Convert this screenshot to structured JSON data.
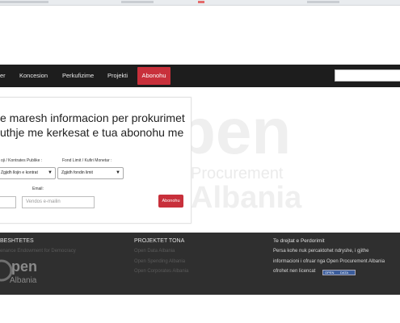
{
  "nav": {
    "items": [
      "er",
      "Koncesion",
      "Perkufizime",
      "Projekti"
    ],
    "cta": "Abonohu"
  },
  "form": {
    "headline_line1": "e maresh informacion per prokurimet",
    "headline_line2": "uthje me kerkesat e tua abonohu me",
    "contract_type_label": "oji / Kontrates Publike :",
    "contract_type_value": "Zgjidh llojin e kontrat",
    "fund_limit_label": "Fond Limit / Kufiri Monetar :",
    "fund_limit_value": "Zgjidh fondin limit",
    "email_label": "Email:",
    "email_placeholder": "Vendos e-mailin",
    "submit_label": "Abonohu"
  },
  "watermark": {
    "word": "pen",
    "procurement": "Procurement",
    "albania": "Albania"
  },
  "footer": {
    "col1_title": "BESHTETES",
    "col1_links": [
      "enance Endowment for Democracy"
    ],
    "col2_title": "PROJEKTET TONA",
    "col2_links": [
      "Open Data Albania",
      "Open Spending Albania",
      "Open Corporates Albania"
    ],
    "col3_title": "Te drejtat e Perdorimit",
    "col3_text": [
      "Persa kohe nuk percaktohet ndryshe, i gjithe",
      "informacioni i ofruar nga Open Procurement Albania",
      "ofrohet nen licencat"
    ],
    "logo_big": "pen",
    "logo_small": "Albania"
  }
}
